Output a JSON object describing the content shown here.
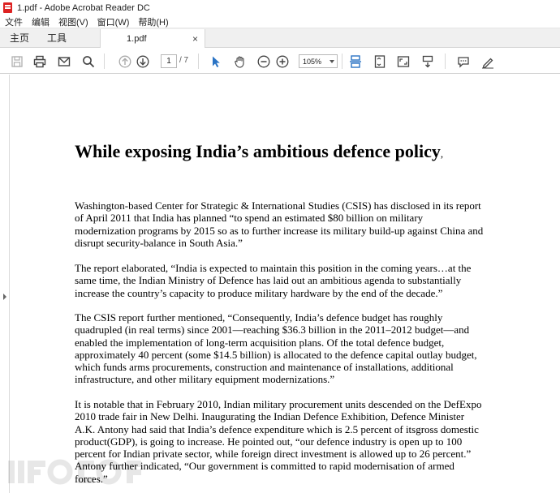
{
  "window": {
    "title": "1.pdf - Adobe Acrobat Reader DC"
  },
  "menu": [
    "文件",
    "编辑",
    "视图(V)",
    "窗口(W)",
    "帮助(H)"
  ],
  "tabs": {
    "home": "主页",
    "tools": "工具",
    "document": "1.pdf",
    "close_glyph": "×"
  },
  "toolbar": {
    "current_page": "1",
    "page_total": "/ 7",
    "zoom": "105%",
    "icons": [
      "save-icon",
      "print-icon",
      "email-icon",
      "search-icon",
      "previous-page-icon",
      "next-page-icon",
      "select-cursor-icon",
      "hand-tool-icon",
      "zoom-out-icon",
      "zoom-in-icon",
      "scrolling-mode-icon",
      "fit-page-icon",
      "fullscreen-icon",
      "rotate-icon",
      "comment-icon",
      "sign-icon"
    ],
    "accent": "#2a73c4"
  },
  "document": {
    "title": "While exposing India’s ambitious defence policy",
    "title_tail": ",",
    "paragraphs": [
      [
        "Washington-based Center for Strategic & International Studies (CSIS) has disclosed in its report",
        "of April 2011 that India has planned “to spend an estimated $80 billion on military",
        "modernization programs by 2015 so as to further increase its military build-up against China and",
        "disrupt security-balance in South Asia.”"
      ],
      [
        "The report elaborated, “India is expected to maintain this position in the coming years…at the",
        "same time, the Indian Ministry of Defence has laid out an ambitious agenda to substantially",
        "increase the country’s capacity to produce military hardware by the end of the decade.”"
      ],
      [
        "The CSIS report further mentioned, “Consequently, India’s defence budget has roughly",
        "quadrupled (in real terms) since 2001—reaching $36.3 billion in the 2011–2012 budget—and",
        "enabled the implementation of long-term acquisition plans. Of the total defence budget,",
        "approximately 40 percent (some $14.5 billion) is allocated to the defence capital outlay budget,",
        "which funds arms procurements, construction and maintenance of installations, additional",
        "infrastructure, and other military equipment modernizations.”"
      ],
      [
        "It is notable that in February 2010, Indian military procurement units descended on the DefExpo",
        "2010 trade fair in New Delhi. Inaugurating the Indian Defence Exhibition, Defence Minister",
        "A.K. Antony had said that India’s defence expenditure which is 2.5 percent of itsgross domestic",
        "product(GDP), is going to increase. He pointed out, “our defence industry is open up to 100",
        "percent for Indian private sector, while foreign direct investment is allowed up to 26 percent.”",
        "Antony further indicated, “Our government is committed to rapid modernisation of armed",
        "forces.”"
      ]
    ]
  }
}
